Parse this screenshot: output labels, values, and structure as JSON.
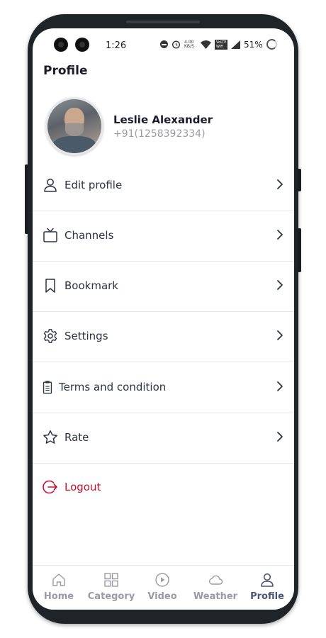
{
  "status_bar": {
    "time": "1:26",
    "network_speed": "4.00 KB/S",
    "wifi_badge": "VoLTE WiFi",
    "battery": "51%"
  },
  "header": {
    "title": "Profile"
  },
  "profile": {
    "name": "Leslie Alexander",
    "phone": "+91(1258392334)"
  },
  "menu": {
    "items": [
      {
        "label": "Edit profile",
        "icon": "user-icon"
      },
      {
        "label": "Channels",
        "icon": "tv-icon"
      },
      {
        "label": "Bookmark",
        "icon": "bookmark-icon"
      },
      {
        "label": "Settings",
        "icon": "gear-icon"
      },
      {
        "label": "Terms and condition",
        "icon": "clipboard-icon"
      },
      {
        "label": "Rate",
        "icon": "star-icon"
      }
    ],
    "logout": {
      "label": "Logout",
      "icon": "logout-icon",
      "color": "#c8102e"
    }
  },
  "bottom_nav": {
    "items": [
      {
        "label": "Home",
        "icon": "home-icon"
      },
      {
        "label": "Category",
        "icon": "grid-icon"
      },
      {
        "label": "Video",
        "icon": "play-icon"
      },
      {
        "label": "Weather",
        "icon": "cloud-icon"
      },
      {
        "label": "Profile",
        "icon": "user-icon",
        "active": true
      }
    ]
  },
  "colors": {
    "accent": "#4b5575",
    "danger": "#c8102e",
    "muted": "#9a9aa6"
  }
}
